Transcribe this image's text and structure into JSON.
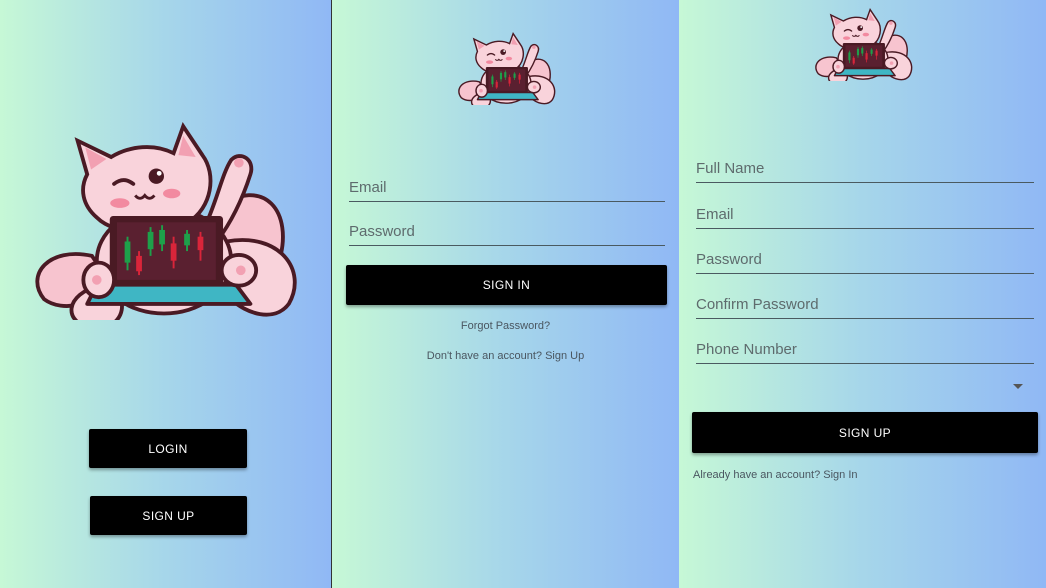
{
  "welcome": {
    "login_label": "LOGIN",
    "signup_label": "SIGN UP"
  },
  "signin": {
    "email_placeholder": "Email",
    "password_placeholder": "Password",
    "signin_label": "SIGN IN",
    "forgot_label": "Forgot Password?",
    "signup_link_label": "Don't have an account? Sign Up"
  },
  "signup": {
    "fullname_placeholder": "Full Name",
    "email_placeholder": "Email",
    "password_placeholder": "Password",
    "confirm_placeholder": "Confirm Password",
    "phone_placeholder": "Phone Number",
    "dropdown_value": "",
    "signup_label": "SIGN UP",
    "signin_link_label": "Already have an account? Sign In"
  },
  "icons": {
    "mascot": "fox-mascot-laptop-icon",
    "dropdown": "caret-down-icon"
  },
  "colors": {
    "button_bg": "#000000",
    "button_text": "#ffffff",
    "gradient_start": "#c6f8d6",
    "gradient_end": "#90b8f5",
    "fox_pink": "#f7c4cf",
    "fox_outline": "#4a1a24"
  }
}
